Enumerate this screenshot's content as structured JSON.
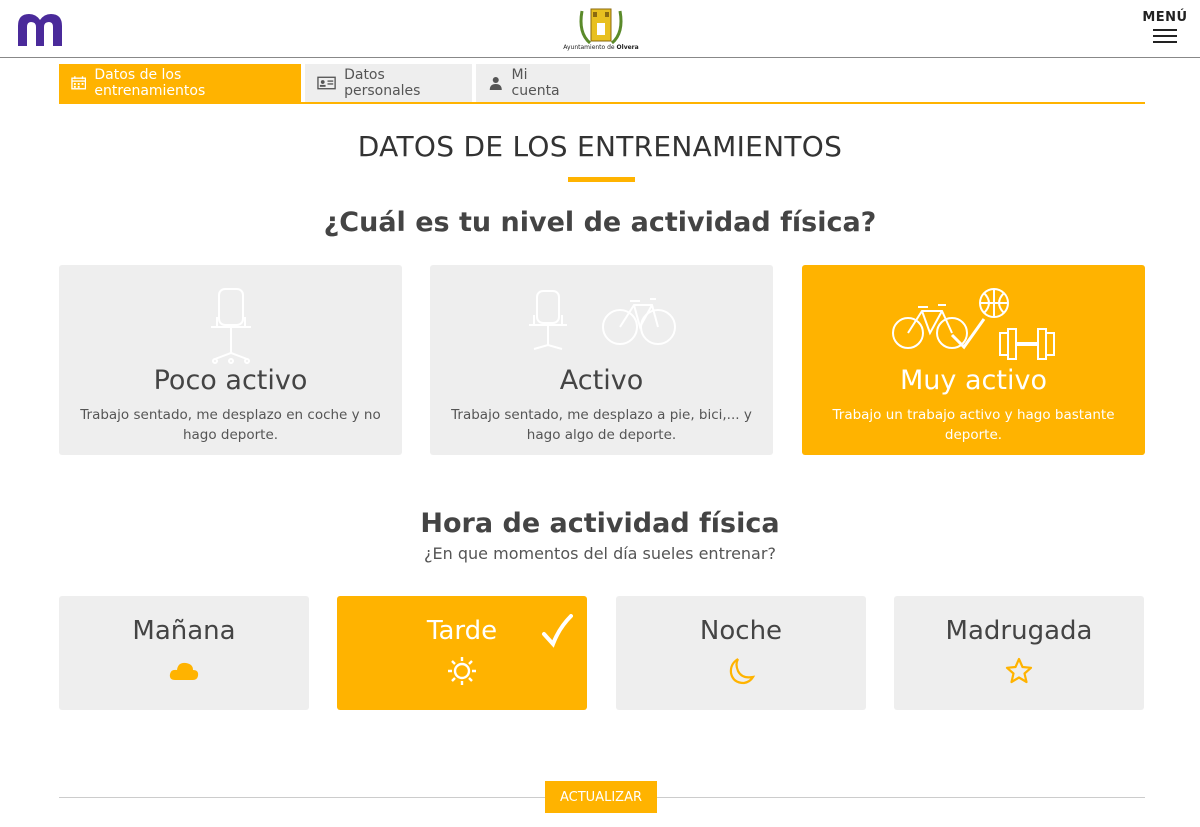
{
  "header": {
    "crest_caption_prefix": "Ayuntamiento de",
    "crest_caption_name": "Olvera",
    "menu_label": "MENÚ"
  },
  "tabs": [
    {
      "label": "Datos de los entrenamientos",
      "icon": "calendar-icon",
      "active": true
    },
    {
      "label": "Datos personales",
      "icon": "id-card-icon",
      "active": false
    },
    {
      "label": "Mi cuenta",
      "icon": "user-icon",
      "active": false
    }
  ],
  "main": {
    "section_title": "DATOS DE LOS ENTRENAMIENTOS",
    "activity_question": "¿Cuál es tu nivel de actividad física?",
    "activity_levels": [
      {
        "name": "Poco activo",
        "description": "Trabajo sentado, me desplazo en coche y no hago deporte.",
        "icon": "office-chair-icon",
        "selected": false
      },
      {
        "name": "Activo",
        "description": "Trabajo sentado, me desplazo a pie, bici,... y hago algo de deporte.",
        "icon": "chair-and-bicycle-icon",
        "selected": false
      },
      {
        "name": "Muy activo",
        "description": "Trabajo un trabajo activo y hago bastante deporte.",
        "icon": "bicycle-ball-dumbbell-icon",
        "selected": true
      }
    ],
    "time_title": "Hora de actividad física",
    "time_question": "¿En que momentos del día sueles entrenar?",
    "time_slots": [
      {
        "name": "Mañana",
        "icon": "cloud-icon",
        "selected": false
      },
      {
        "name": "Tarde",
        "icon": "sun-icon",
        "selected": true
      },
      {
        "name": "Noche",
        "icon": "moon-icon",
        "selected": false
      },
      {
        "name": "Madrugada",
        "icon": "star-icon",
        "selected": false
      }
    ],
    "update_button": "ACTUALIZAR"
  },
  "colors": {
    "accent": "#ffb300",
    "brand_purple": "#4a2a9a",
    "card_bg": "#eeeeee"
  }
}
